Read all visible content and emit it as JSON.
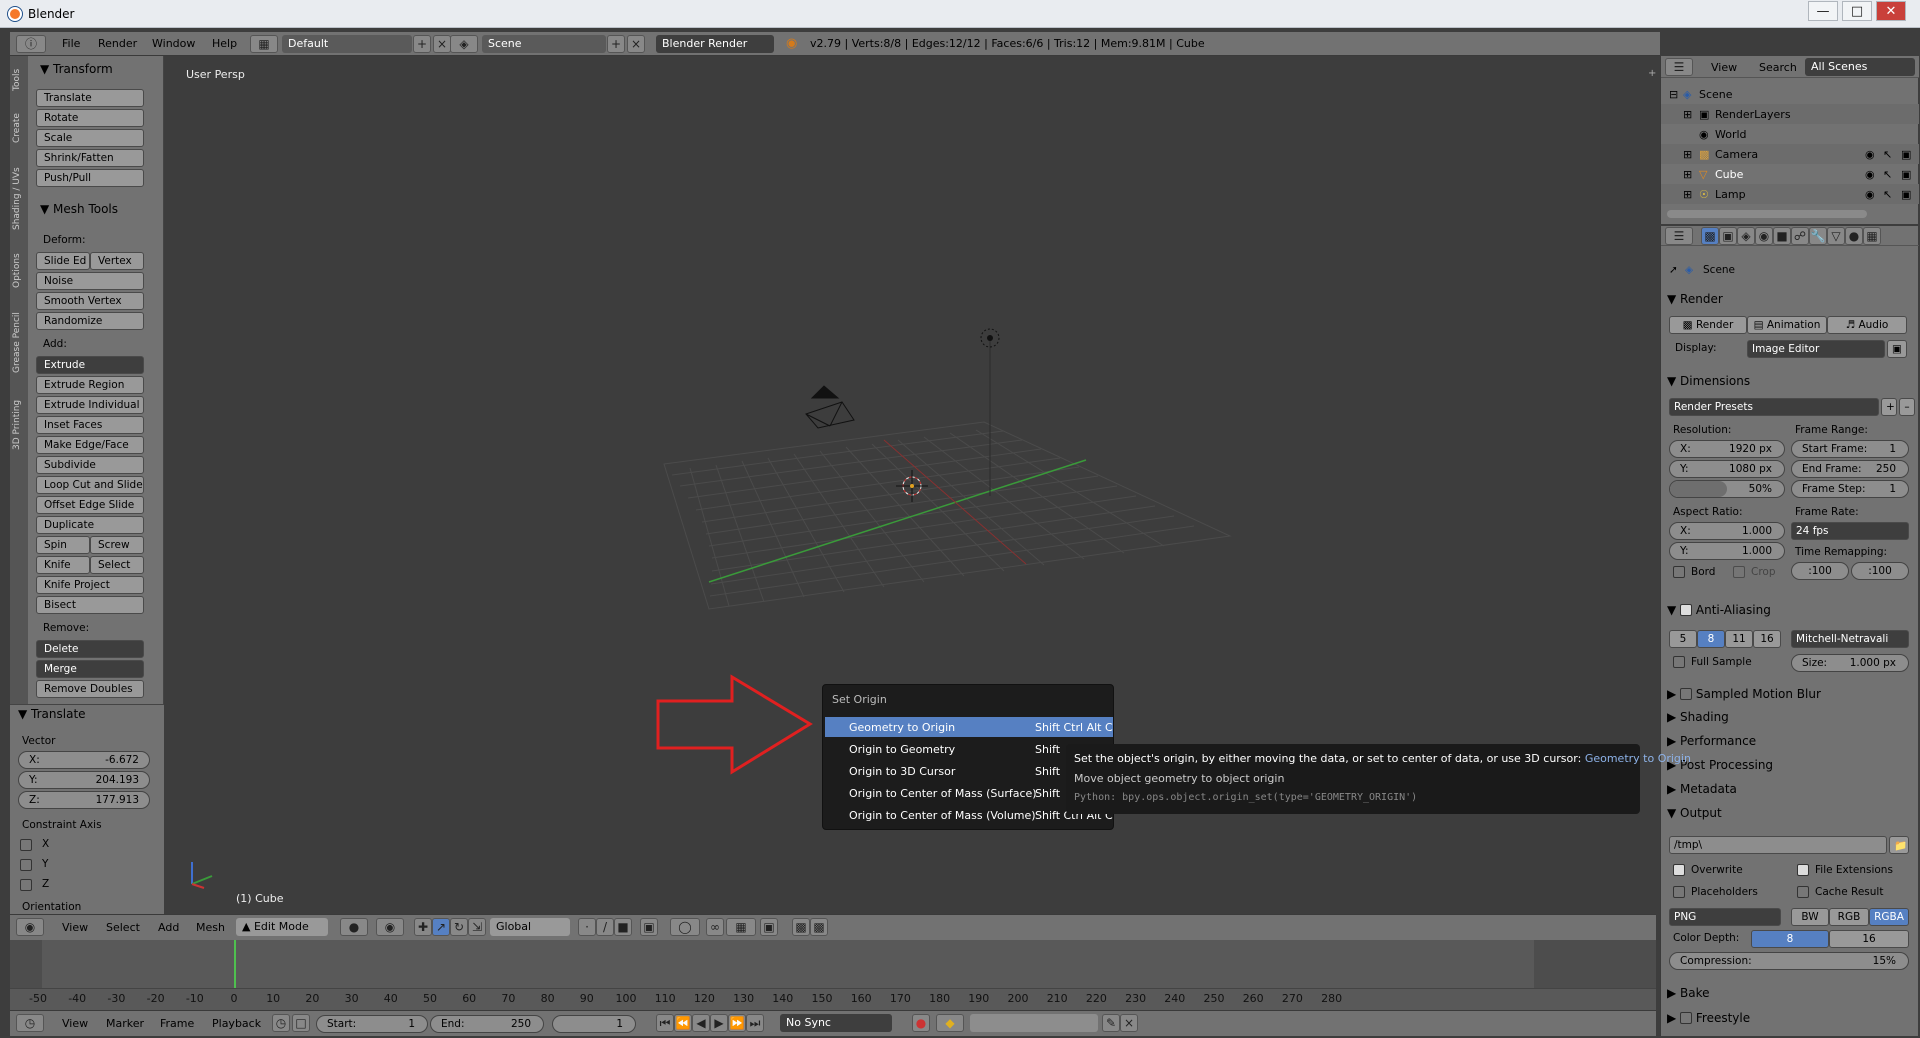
{
  "window": {
    "title": "Blender"
  },
  "info_header": {
    "menus": [
      "File",
      "Render",
      "Window",
      "Help"
    ],
    "layout": "Default",
    "scene": "Scene",
    "engine": "Blender Render",
    "stats": "v2.79 | Verts:8/8 | Edges:12/12 | Faces:6/6 | Tris:12 | Mem:9.81M | Cube"
  },
  "left_tabs": [
    "Tools",
    "Create",
    "Shading / UVs",
    "Options",
    "Grease Pencil",
    "3D Printing"
  ],
  "toolshelf": {
    "transform": {
      "title": "Transform",
      "buttons": [
        "Translate",
        "Rotate",
        "Scale",
        "Shrink/Fatten",
        "Push/Pull"
      ]
    },
    "mesh_tools": {
      "title": "Mesh Tools",
      "deform_label": "Deform:",
      "slide_edge": "Slide Ed",
      "vertex": "Vertex",
      "noise": "Noise",
      "smooth_vertex": "Smooth Vertex",
      "randomize": "Randomize",
      "add_label": "Add:",
      "extrude": "Extrude",
      "extrude_region": "Extrude Region",
      "extrude_individual": "Extrude Individual",
      "inset_faces": "Inset Faces",
      "make_edge_face": "Make Edge/Face",
      "subdivide": "Subdivide",
      "loop_cut": "Loop Cut and Slide",
      "offset_edge": "Offset Edge Slide",
      "duplicate": "Duplicate",
      "spin": "Spin",
      "screw": "Screw",
      "knife": "Knife",
      "select": "Select",
      "knife_project": "Knife Project",
      "bisect": "Bisect",
      "remove_label": "Remove:",
      "delete": "Delete",
      "merge": "Merge",
      "remove_doubles": "Remove Doubles"
    },
    "translate_op": {
      "title": "Translate",
      "vector_label": "Vector",
      "x_label": "X:",
      "x": "-6.672",
      "y_label": "Y:",
      "y": "204.193",
      "z_label": "Z:",
      "z": "177.913",
      "constraint_label": "Constraint Axis",
      "axes": [
        "X",
        "Y",
        "Z"
      ],
      "orientation_label": "Orientation"
    }
  },
  "viewport": {
    "label": "User Persp",
    "object_label": "(1) Cube"
  },
  "viewport_header": {
    "menus": [
      "View",
      "Select",
      "Add",
      "Mesh"
    ],
    "mode": "Edit Mode",
    "orientation": "Global"
  },
  "timeline": {
    "ticks": [
      "-50",
      "-40",
      "-30",
      "-20",
      "-10",
      "0",
      "10",
      "20",
      "30",
      "40",
      "50",
      "60",
      "70",
      "80",
      "90",
      "100",
      "110",
      "120",
      "130",
      "140",
      "150",
      "160",
      "170",
      "180",
      "190",
      "200",
      "210",
      "220",
      "230",
      "240",
      "250",
      "260",
      "270",
      "280"
    ],
    "current_frame_value": 0
  },
  "timeline_header": {
    "menus": [
      "View",
      "Marker",
      "Frame",
      "Playback"
    ],
    "start_label": "Start:",
    "start": "1",
    "end_label": "End:",
    "end": "250",
    "current": "1",
    "sync": "No Sync"
  },
  "outliner": {
    "header": {
      "view": "View",
      "search": "Search",
      "scope": "All Scenes"
    },
    "items": [
      "Scene",
      "RenderLayers",
      "World",
      "Camera",
      "Cube",
      "Lamp"
    ]
  },
  "properties": {
    "scene": "Scene",
    "render_section": "Render",
    "render_btn": "Render",
    "animation_btn": "Animation",
    "audio_btn": "Audio",
    "display_label": "Display:",
    "display": "Image Editor",
    "dimensions": "Dimensions",
    "render_presets": "Render Presets",
    "resolution_label": "Resolution:",
    "res_x_label": "X:",
    "res_x": "1920 px",
    "res_y_label": "Y:",
    "res_y": "1080 px",
    "res_pct": "50%",
    "frame_range_label": "Frame Range:",
    "start_frame_label": "Start Frame:",
    "start_frame": "1",
    "end_frame_label": "End Frame:",
    "end_frame": "250",
    "frame_step_label": "Frame Step:",
    "frame_step": "1",
    "aspect_label": "Aspect Ratio:",
    "aspect_x_label": "X:",
    "aspect_x": "1.000",
    "aspect_y_label": "Y:",
    "aspect_y": "1.000",
    "frame_rate_label": "Frame Rate:",
    "frame_rate": "24 fps",
    "time_remap_label": "Time Remapping:",
    "remap_old": ":100",
    "remap_new": ":100",
    "bord": "Bord",
    "crop": "Crop",
    "anti_aliasing": "Anti-Aliasing",
    "aa_samples": [
      "5",
      "8",
      "11",
      "16"
    ],
    "aa_filter": "Mitchell-Netravali",
    "full_sample": "Full Sample",
    "size_label": "Size:",
    "size": "1.000 px",
    "sampled_motion_blur": "Sampled Motion Blur",
    "shading": "Shading",
    "performance": "Performance",
    "post_processing": "Post Processing",
    "metadata": "Metadata",
    "output": "Output",
    "output_path": "/tmp\\",
    "overwrite": "Overwrite",
    "file_extensions": "File Extensions",
    "placeholders": "Placeholders",
    "cache_result": "Cache Result",
    "format": "PNG",
    "bw": "BW",
    "rgb": "RGB",
    "rgba": "RGBA",
    "color_depth_label": "Color Depth:",
    "depth_8": "8",
    "depth_16": "16",
    "compression_label": "Compression:",
    "compression": "15%",
    "bake": "Bake",
    "freestyle": "Freestyle"
  },
  "popup_menu": {
    "title": "Set Origin",
    "items": [
      {
        "label": "Geometry to Origin",
        "shortcut": "Shift Ctrl Alt C"
      },
      {
        "label": "Origin to Geometry",
        "shortcut": "Shift"
      },
      {
        "label": "Origin to 3D Cursor",
        "shortcut": "Shift"
      },
      {
        "label": "Origin to Center of Mass (Surface)",
        "shortcut": "Shift"
      },
      {
        "label": "Origin to Center of Mass (Volume)",
        "shortcut": "Shift Ctrl Alt C"
      }
    ]
  },
  "tooltip": {
    "line1": "Set the object's origin, by either moving the data, or set to center of data, or use 3D cursor:",
    "line1_highlight": "Geometry to Origin",
    "line2": "Move object geometry to object origin",
    "line3": "Python: bpy.ops.object.origin_set(type='GEOMETRY_ORIGIN')"
  },
  "colors": {
    "accent": "#5680c2",
    "annotation_arrow": "#e02020",
    "x_axis": "#b03030",
    "y_axis": "#30a030"
  }
}
